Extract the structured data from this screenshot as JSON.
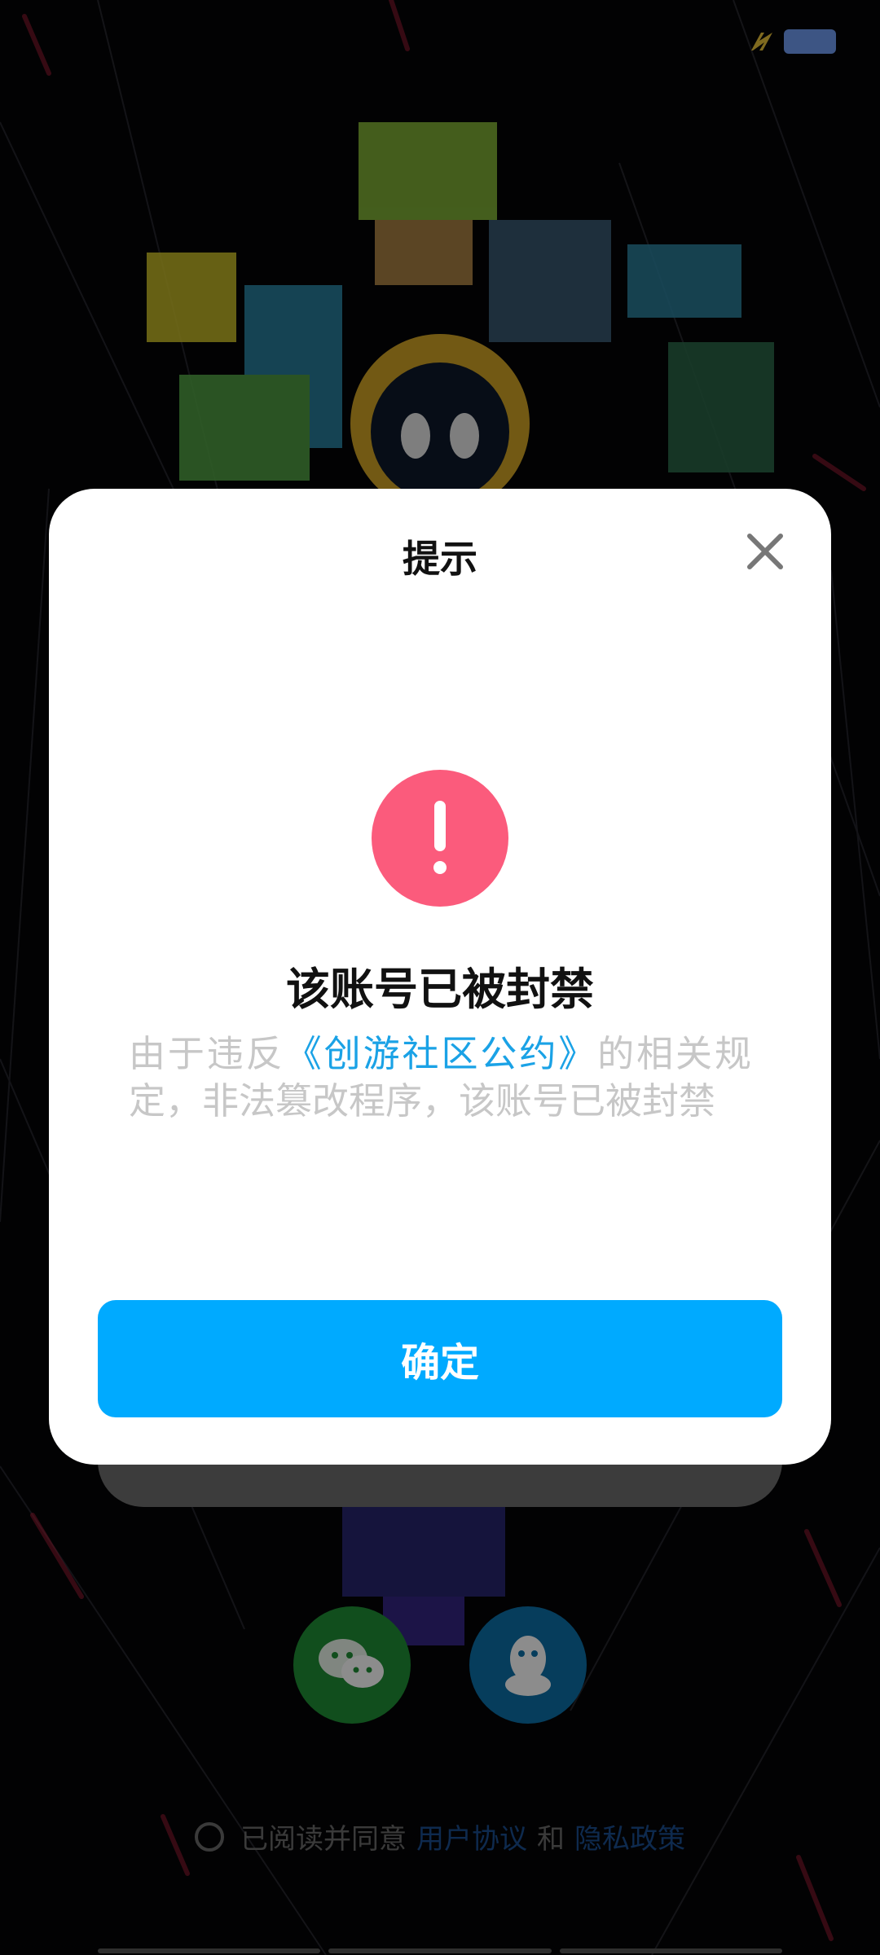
{
  "dialog": {
    "title": "提示",
    "heading": "该账号已被封禁",
    "message_prefix": "由于违反",
    "message_link": "《创游社区公约》",
    "message_suffix": "的相关规定，非法篡改程序，该账号已被封禁",
    "confirm_label": "确定",
    "close_icon": "close-icon",
    "alert_icon": "exclamation-icon",
    "colors": {
      "alert": "#fb5b7c",
      "confirm": "#00aaff",
      "link": "#1aa2e6"
    }
  },
  "login": {
    "social": [
      {
        "name": "wechat",
        "icon": "wechat-icon",
        "color": "#1f8e35"
      },
      {
        "name": "qq",
        "icon": "qq-icon",
        "color": "#0b6fa8"
      }
    ],
    "agreement": {
      "prefix": "已阅读并同意",
      "user_agreement": "用户协议",
      "conjunction": "和",
      "privacy_policy": "隐私政策"
    }
  },
  "status_bar": {
    "icons": [
      "charging-icon",
      "battery-icon"
    ]
  }
}
